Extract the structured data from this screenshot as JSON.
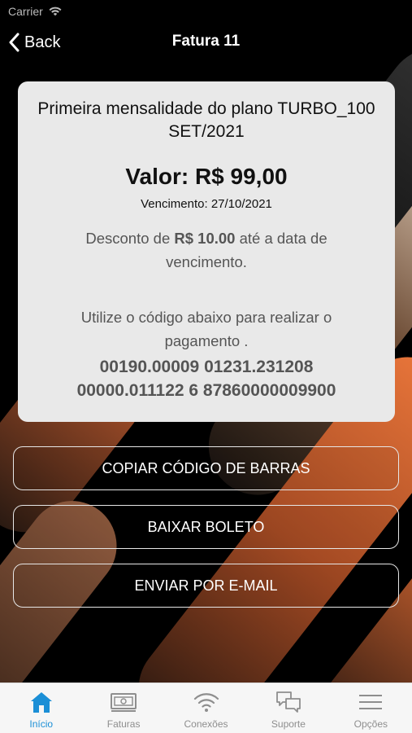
{
  "status_bar": {
    "carrier": "Carrier"
  },
  "nav": {
    "back_label": "Back",
    "title": "Fatura 11"
  },
  "invoice": {
    "description": "Primeira mensalidade do plano TURBO_100 SET/2021",
    "amount": "Valor: R$ 99,00",
    "due_date": "Vencimento: 27/10/2021",
    "discount_prefix": "Desconto de ",
    "discount_value": "R$ 10.00",
    "discount_suffix": " até a data de vencimento.",
    "instructions": "Utilize o código abaixo para realizar o pagamento .",
    "barcode_line1": "00190.00009 01231.231208",
    "barcode_line2": "00000.011122 6 87860000009900"
  },
  "actions": {
    "copy_barcode": "COPIAR CÓDIGO DE BARRAS",
    "download_boleto": "BAIXAR BOLETO",
    "send_email": "ENVIAR POR E-MAIL"
  },
  "tabs": [
    {
      "label": "Início",
      "icon": "home-icon",
      "active": true
    },
    {
      "label": "Faturas",
      "icon": "invoices-icon",
      "active": false
    },
    {
      "label": "Conexões",
      "icon": "wifi-icon",
      "active": false
    },
    {
      "label": "Suporte",
      "icon": "chat-icon",
      "active": false
    },
    {
      "label": "Opções",
      "icon": "menu-icon",
      "active": false
    }
  ],
  "colors": {
    "accent": "#1b8fd6",
    "card_background": "#e9e9e9",
    "page_background": "#000000",
    "stripe_orange": "#e8753a"
  }
}
